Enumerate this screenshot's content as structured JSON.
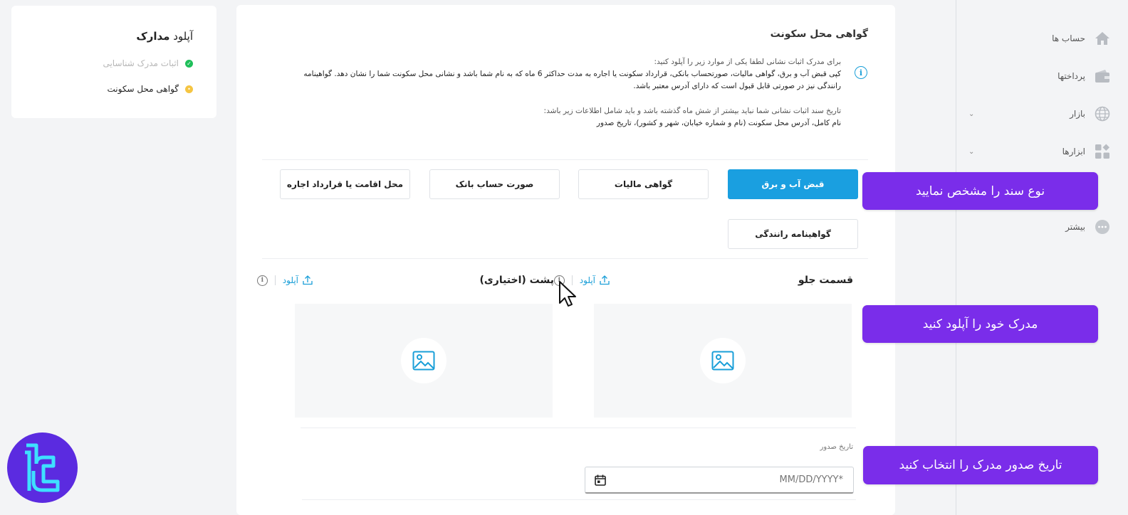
{
  "steps_card": {
    "title_prefix": "آپلود",
    "title_bold": "مدارک",
    "steps": [
      {
        "label": "اثبات مدرک شناسایی",
        "status": "done"
      },
      {
        "label": "گواهی محل سکونت",
        "status": "active"
      }
    ]
  },
  "main": {
    "title": "گواهی محل سکونت",
    "info": {
      "lead": "برای مدرک اثبات نشانی لطفا یکی از موارد زیر را آپلود کنید:",
      "body": "کپی قبض آب و برق، گواهی مالیات، صورتحساب بانکی، قرارداد سکونت یا اجاره به مدت حداکثر 6 ماه که به نام شما باشد و نشانی محل سکونت شما را نشان دهد. گواهینامه رانندگی نیز در صورتی قابل قبول است که دارای آدرس معتبر باشد.",
      "lead2": "تاریخ سند اثبات نشانی شما نباید بیشتر از شش ماه گذشته باشد و باید شامل اطلاعات زیر باشد:",
      "body2": "نام کامل، آدرس محل سکونت (نام و شماره خیابان، شهر و کشور)، تاریخ صدور"
    },
    "doc_types": [
      "قبض آب و برق",
      "گواهی مالیات",
      "صورت حساب بانک",
      "محل اقامت یا قرارداد اجاره",
      "گواهینامه رانندگی"
    ],
    "selected_doc": "قبض آب و برق",
    "front": {
      "title": "قسمت جلو",
      "upload_label": "آپلود"
    },
    "back": {
      "title": "پشت (اختیاری)",
      "upload_label": "آپلود"
    },
    "issue_date": {
      "label": "تاریخ صدور",
      "placeholder": "MM/DD/YYYY*"
    }
  },
  "sidebar": {
    "items": [
      {
        "label": "حساب ها",
        "icon": "home-icon"
      },
      {
        "label": "پرداختها",
        "icon": "wallet-icon"
      },
      {
        "label": "بازار",
        "icon": "globe-icon",
        "chevron": true
      },
      {
        "label": "ابزارها",
        "icon": "grid-icon",
        "chevron": true
      },
      {
        "label": "بیشتر",
        "icon": "more-icon"
      }
    ]
  },
  "annotations": [
    "نوع سند را مشخص نمایید",
    "مدرک خود را آپلود کنید",
    "تاریخ صدور مدرک را انتخاب کنید"
  ],
  "colors": {
    "primary": "#1a9fe0",
    "annotation": "#7a2dea",
    "success": "#1fbf5a",
    "pending": "#f5c542",
    "logo": "#5b2be0"
  }
}
